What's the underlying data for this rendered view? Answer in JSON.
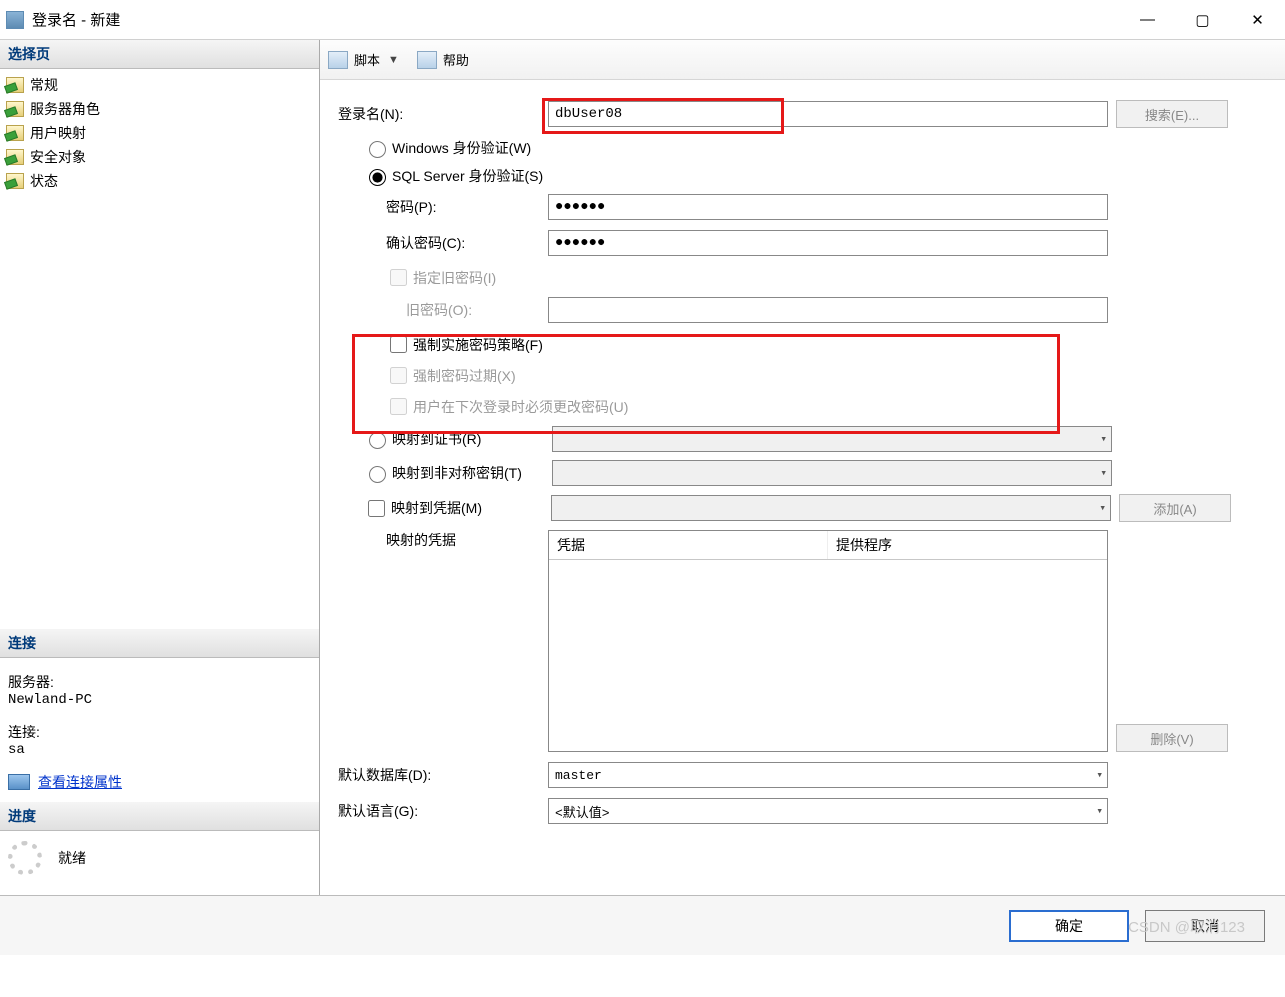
{
  "window": {
    "title": "登录名 - 新建"
  },
  "sidebar": {
    "select_header": "选择页",
    "items": [
      {
        "label": "常规"
      },
      {
        "label": "服务器角色"
      },
      {
        "label": "用户映射"
      },
      {
        "label": "安全对象"
      },
      {
        "label": "状态"
      }
    ],
    "conn_header": "连接",
    "server_label": "服务器:",
    "server_value": "Newland-PC",
    "conn_label": "连接:",
    "conn_value": "sa",
    "view_conn_props": "查看连接属性",
    "progress_header": "进度",
    "progress_text": "就绪"
  },
  "toolbar": {
    "script": "脚本",
    "help": "帮助"
  },
  "form": {
    "login_label": "登录名(N):",
    "login_value": "dbUser08",
    "search_btn": "搜索(E)...",
    "auth_windows": "Windows 身份验证(W)",
    "auth_sql": "SQL Server 身份验证(S)",
    "password_label": "密码(P):",
    "password_value": "●●●●●●",
    "confirm_label": "确认密码(C):",
    "confirm_value": "●●●●●●",
    "specify_old": "指定旧密码(I)",
    "old_pw_label": "旧密码(O):",
    "enforce_policy": "强制实施密码策略(F)",
    "enforce_expire": "强制密码过期(X)",
    "must_change": "用户在下次登录时必须更改密码(U)",
    "map_cert": "映射到证书(R)",
    "map_asym": "映射到非对称密钥(T)",
    "map_cred": "映射到凭据(M)",
    "add_btn": "添加(A)",
    "mapped_cred": "映射的凭据",
    "col_cred": "凭据",
    "col_provider": "提供程序",
    "delete_btn": "删除(V)",
    "default_db_label": "默认数据库(D):",
    "default_db_value": "master",
    "default_lang_label": "默认语言(G):",
    "default_lang_value": "<默认值>"
  },
  "buttons": {
    "ok": "确定",
    "cancel": "取消"
  },
  "watermark": "CSDN @取消123"
}
